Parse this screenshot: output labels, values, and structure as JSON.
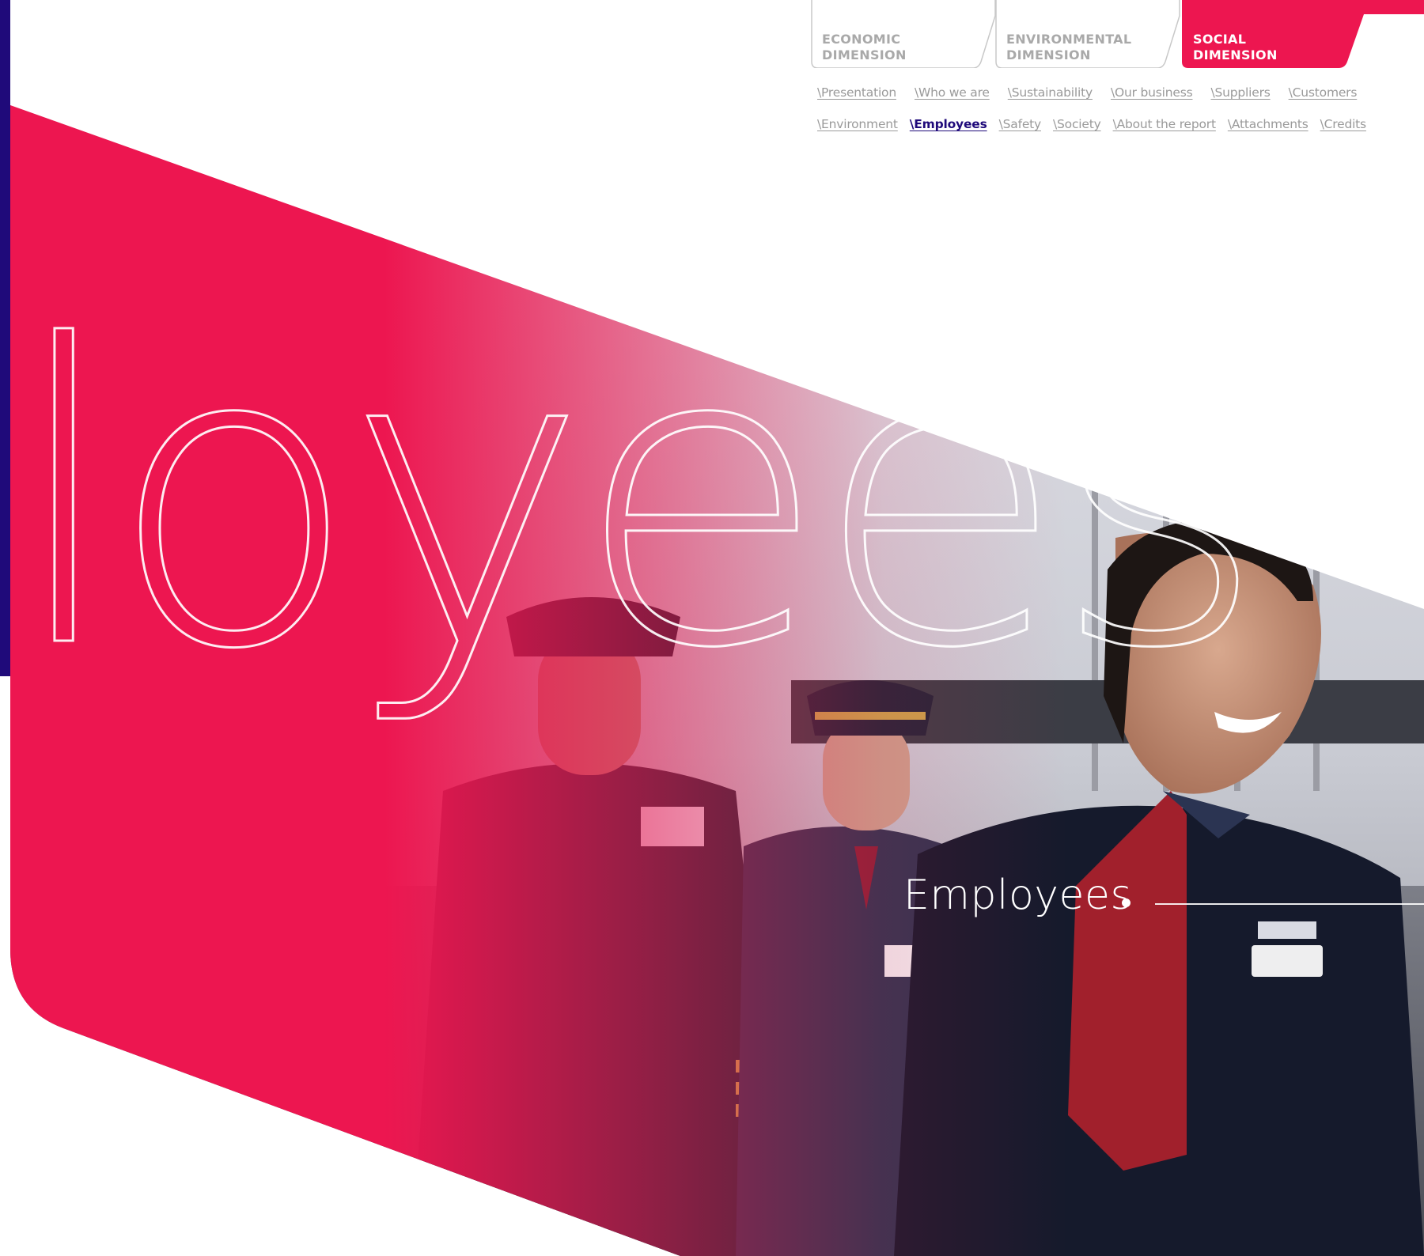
{
  "hero": {
    "big_word": "loyees",
    "section_title": "Employees",
    "photo_description_icon": "crew-photo"
  },
  "colors": {
    "brand_red": "#ed1650",
    "brand_navy": "#1f0a7a",
    "tab_grey": "#a9a9a9"
  },
  "dimension_tabs": [
    {
      "line1": "ECONOMIC",
      "line2": "DIMENSION",
      "active": false
    },
    {
      "line1": "ENVIRONMENTAL",
      "line2": "DIMENSION",
      "active": false
    },
    {
      "line1": "SOCIAL",
      "line2": "DIMENSION",
      "active": true
    }
  ],
  "nav": {
    "row1": [
      "\\Presentation",
      "\\Who we are",
      "\\Sustainability",
      "\\Our business",
      "\\Suppliers",
      "\\Customers"
    ],
    "row2": [
      "\\Environment",
      "\\Employees",
      "\\Safety",
      "\\Society",
      "\\About the report",
      "\\Attachments",
      "\\Credits"
    ],
    "active": "\\Employees"
  }
}
